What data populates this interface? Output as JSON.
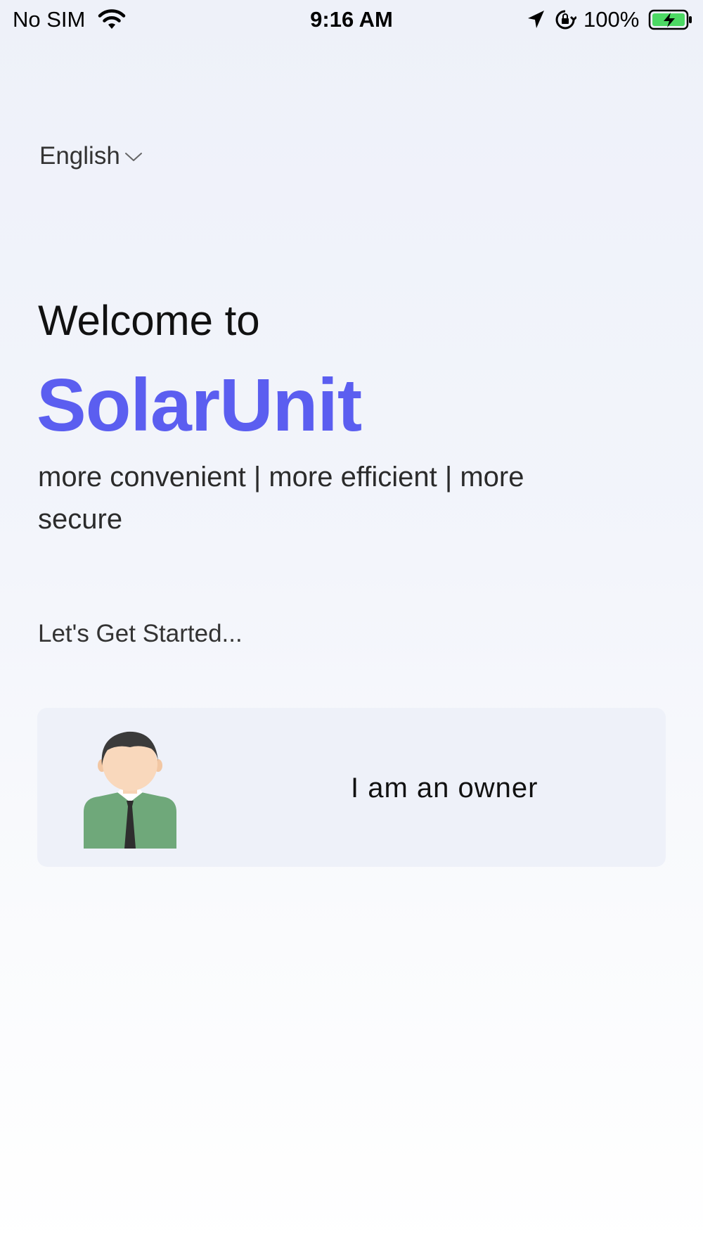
{
  "status_bar": {
    "carrier": "No SIM",
    "time": "9:16 AM",
    "battery_percent": "100%",
    "icons": [
      "wifi-icon",
      "location-arrow-icon",
      "orientation-lock-icon",
      "battery-charging-icon"
    ]
  },
  "language": {
    "selected": "English",
    "icon": "chevron-down-icon"
  },
  "hero": {
    "welcome": "Welcome to",
    "brand": "SolarUnit",
    "tagline": "more convenient | more efficient | more secure"
  },
  "get_started": "Let's Get Started...",
  "role_card": {
    "label": "I am an owner",
    "icon": "owner-avatar-icon"
  },
  "colors": {
    "brand": "#5b5ef0",
    "card_background": "#eef1f9",
    "avatar_shirt": "#6fa87a",
    "battery_fill": "#4cd964"
  }
}
